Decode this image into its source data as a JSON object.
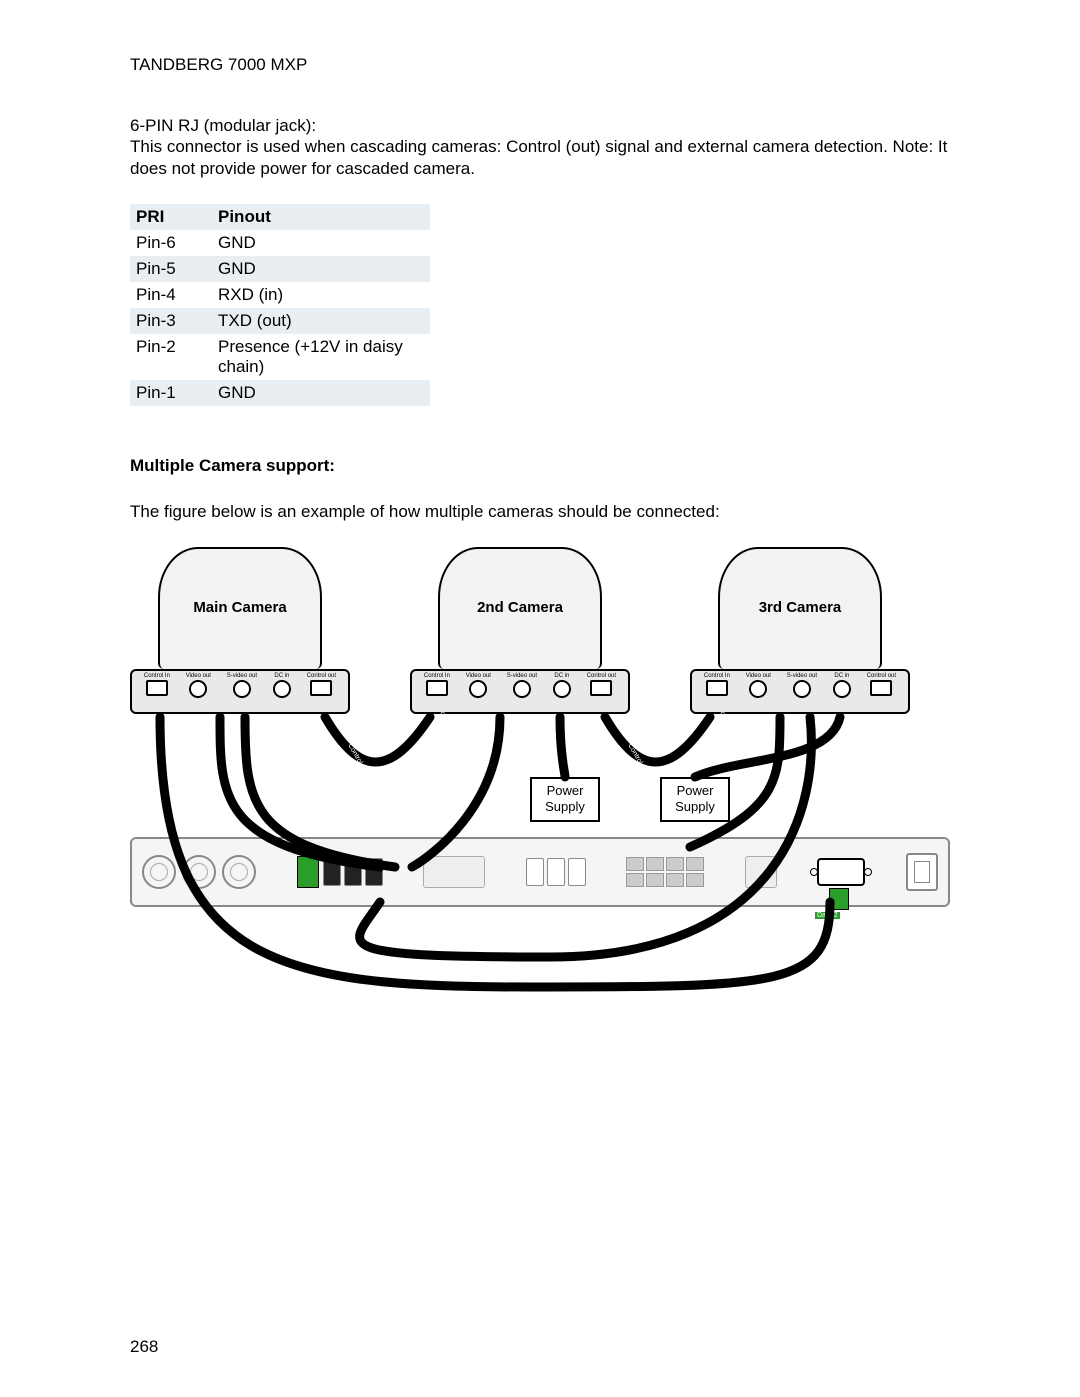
{
  "header": {
    "title": "TANDBERG 7000 MXP"
  },
  "section_rj": {
    "subtitle": "6-PIN RJ (modular jack):",
    "description": "This connector is used when cascading cameras: Control (out) signal and external camera detection. Note: It does not provide power for cascaded camera."
  },
  "pinout_table": {
    "headers": {
      "col1": "PRI",
      "col2": "Pinout"
    },
    "rows": [
      {
        "pin": "Pin-6",
        "value": "GND"
      },
      {
        "pin": "Pin-5",
        "value": "GND"
      },
      {
        "pin": "Pin-4",
        "value": "RXD (in)"
      },
      {
        "pin": "Pin-3",
        "value": "TXD (out)"
      },
      {
        "pin": "Pin-2",
        "value": "Presence (+12V in daisy chain)"
      },
      {
        "pin": "Pin-1",
        "value": "GND"
      }
    ]
  },
  "multi_camera": {
    "heading": "Multiple Camera support:",
    "intro": "The figure below is an example of how multiple cameras should be connected:"
  },
  "diagram": {
    "cameras": {
      "main": {
        "label": "Main Camera"
      },
      "second": {
        "label": "2nd Camera"
      },
      "third": {
        "label": "3rd Camera"
      }
    },
    "camera_ports": [
      {
        "name": "Control In"
      },
      {
        "name": "Video out"
      },
      {
        "name": "S-video out"
      },
      {
        "name": "DC in"
      },
      {
        "name": "Control out"
      }
    ],
    "cable_labels": {
      "control_out": "Control Out",
      "control_in": "Control In"
    },
    "power_supply": {
      "line1": "Power",
      "line2": "Supply"
    },
    "codec_labels": {
      "data_port": "Data 2"
    }
  },
  "page_number": "268"
}
